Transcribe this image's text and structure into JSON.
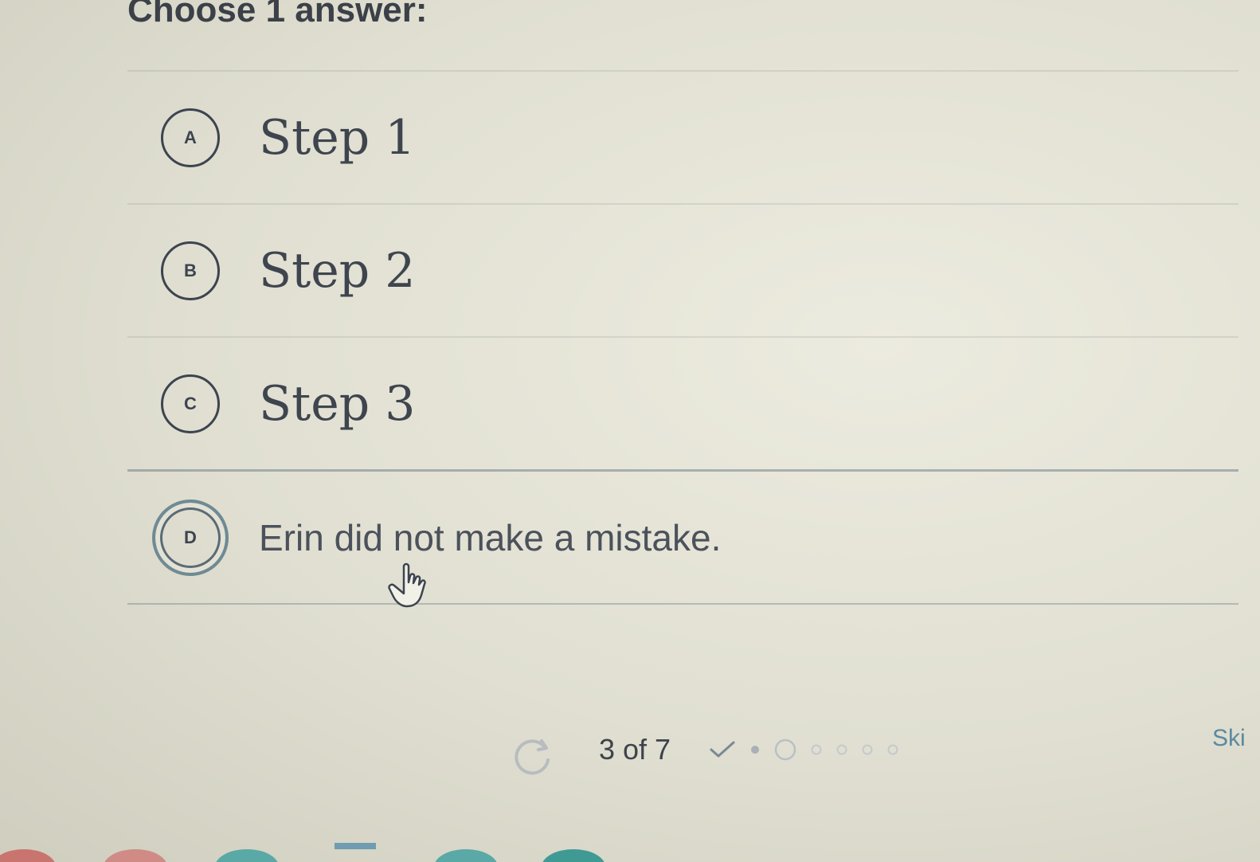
{
  "question": {
    "prompt": "Choose 1 answer:"
  },
  "choices": [
    {
      "letter": "A",
      "label": "Step 1",
      "selected": false
    },
    {
      "letter": "B",
      "label": "Step 2",
      "selected": false
    },
    {
      "letter": "C",
      "label": "Step 3",
      "selected": false
    },
    {
      "letter": "D",
      "label": "Erin did not make a mistake.",
      "selected": true
    }
  ],
  "footer": {
    "progress": "3 of 7",
    "progress_current": 3,
    "progress_total": 7,
    "skip_label": "Ski",
    "refresh_icon": "refresh-icon",
    "check_icon": "check-icon"
  },
  "colors": {
    "background": "#e4e3d6",
    "text": "#4a4f57",
    "selected_ring": "#6f8a94",
    "link": "#5a8aa0"
  }
}
